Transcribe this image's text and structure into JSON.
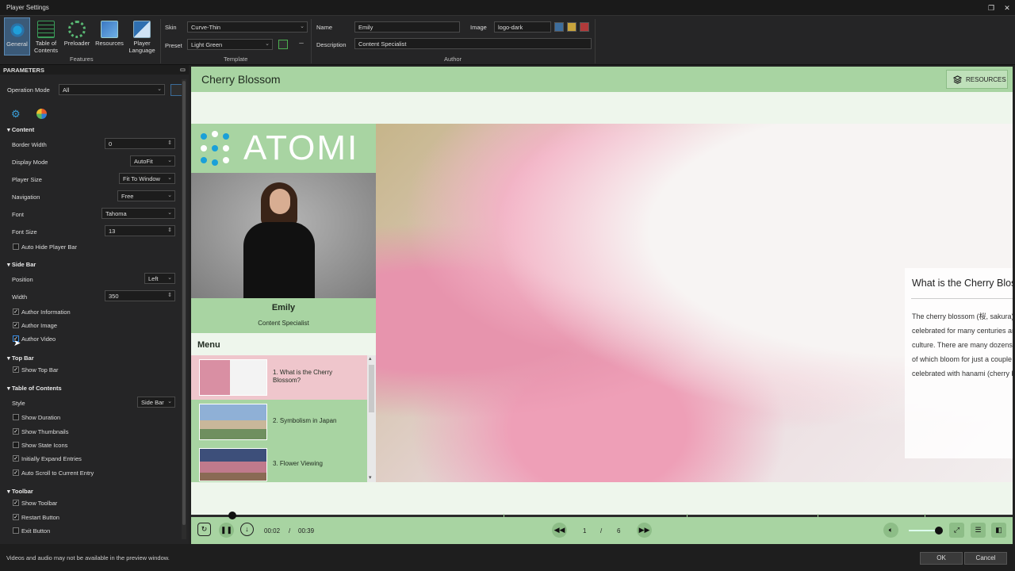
{
  "window": {
    "title": "Player Settings"
  },
  "ribbon": {
    "features": [
      "General",
      "Table of\nContents",
      "Preloader",
      "Resources",
      "Player\nLanguage"
    ],
    "features_label": "Features",
    "template": {
      "skin_label": "Skin",
      "skin_value": "Curve-Thin",
      "preset_label": "Preset",
      "preset_value": "Light Green",
      "group_label": "Template"
    },
    "author": {
      "name_label": "Name",
      "name_value": "Emily",
      "desc_label": "Description",
      "desc_value": "Content Specialist",
      "image_label": "Image",
      "image_value": "logo-dark",
      "group_label": "Author"
    }
  },
  "params": {
    "title": "PARAMETERS",
    "operation_mode_label": "Operation Mode",
    "operation_mode_value": "All",
    "content": {
      "title": "Content",
      "border_width_label": "Border Width",
      "border_width_value": "0",
      "display_mode_label": "Display Mode",
      "display_mode_value": "AutoFit",
      "player_size_label": "Player Size",
      "player_size_value": "Fit To Window",
      "navigation_label": "Navigation",
      "navigation_value": "Free",
      "font_label": "Font",
      "font_value": "Tahoma",
      "font_size_label": "Font Size",
      "font_size_value": "13",
      "auto_hide_label": "Auto Hide Player Bar"
    },
    "sidebar": {
      "title": "Side Bar",
      "position_label": "Position",
      "position_value": "Left",
      "width_label": "Width",
      "width_value": "350",
      "author_info": "Author Information",
      "author_image": "Author Image",
      "author_video": "Author Video"
    },
    "topbar": {
      "title": "Top Bar",
      "show_top_bar": "Show Top Bar"
    },
    "toc": {
      "title": "Table of Contents",
      "style_label": "Style",
      "style_value": "Side Bar",
      "show_duration": "Show Duration",
      "show_thumbnails": "Show Thumbnails",
      "show_state_icons": "Show State Icons",
      "initially_expand": "Initially Expand Entries",
      "auto_scroll": "Auto Scroll to Current Entry"
    },
    "toolbar": {
      "title": "Toolbar",
      "show_toolbar": "Show Toolbar",
      "restart_button": "Restart Button",
      "exit_button": "Exit Button"
    }
  },
  "preview": {
    "title": "Cherry Blossom",
    "resources_label": "RESOURCES",
    "logo_text": "ATOMI",
    "author_name": "Emily",
    "author_desc": "Content Specialist",
    "menu_title": "Menu",
    "menu_items": [
      "1. What is the Cherry Blossom?",
      "2. Symbolism in Japan",
      "3. Flower Viewing"
    ],
    "card_title": "What is the Cherry Blossom?",
    "card_body": "The cherry blossom (桜, sakura) is Japan's unofficial national flower. It has been celebrated for many centuries and holds a very prominent position in Japanese culture. There are many dozens of different cherry tree varieties in Japan, most of which bloom for just a couple of days in spring. The seasonal spectacle is celebrated with hanami (cherry blossom viewing) parties under the trees.",
    "time_current": "00:02",
    "time_sep": "/",
    "time_total": "00:39",
    "progress": 0.05,
    "slide_current": "1",
    "slide_sep": "/",
    "slide_total": "6",
    "volume": 1.0
  },
  "status": {
    "message": "Videos and audio may not be available in the preview window.",
    "ok_label": "OK",
    "cancel_label": "Cancel"
  }
}
